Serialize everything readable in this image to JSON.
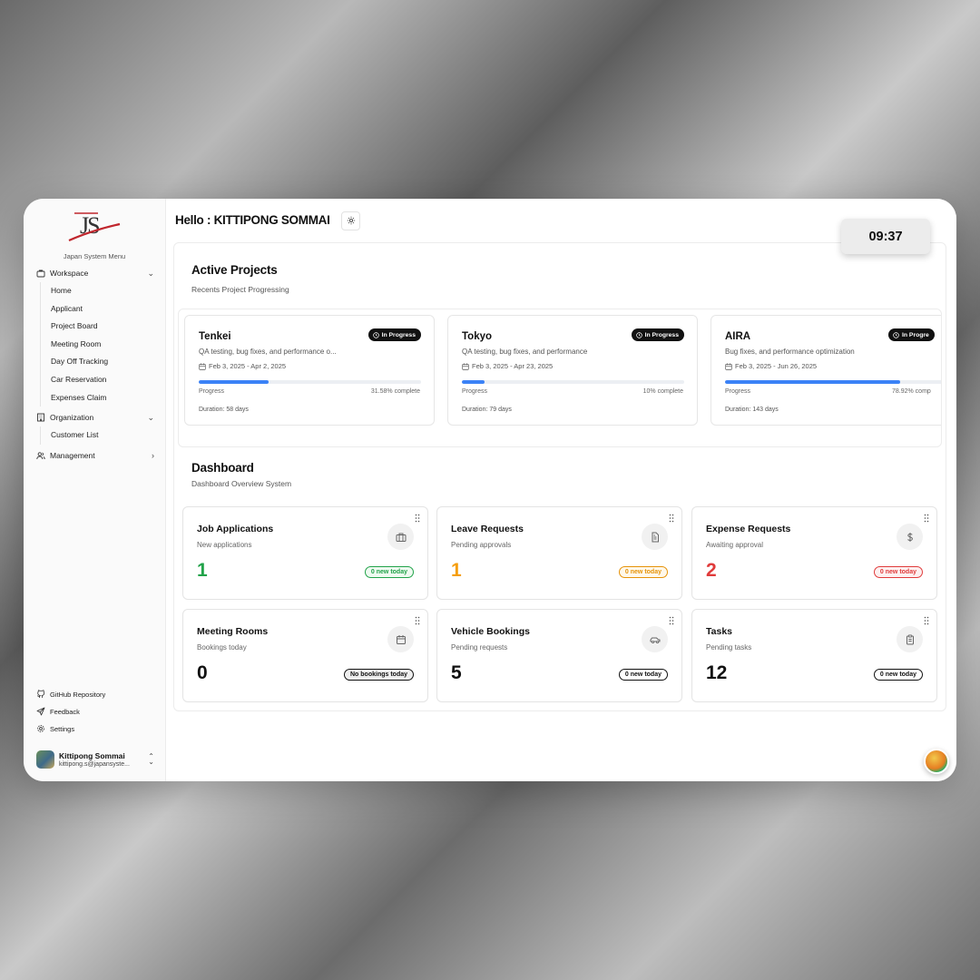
{
  "sidebar": {
    "menu_title": "Japan System Menu",
    "groups": {
      "workspace": {
        "label": "Workspace",
        "icon": "briefcase-icon",
        "items": [
          "Home",
          "Applicant",
          "Project Board",
          "Meeting Room",
          "Day Off Tracking",
          "Car Reservation",
          "Expenses Claim"
        ]
      },
      "organization": {
        "label": "Organization",
        "icon": "building-icon",
        "items": [
          "Customer List"
        ]
      },
      "management": {
        "label": "Management",
        "icon": "users-icon"
      }
    },
    "footer": {
      "github": "GitHub Repository",
      "feedback": "Feedback",
      "settings": "Settings"
    },
    "user": {
      "name": "Kittipong Sommai",
      "email": "kittipong.s@japansyste..."
    }
  },
  "header": {
    "greeting": "Hello : KITTIPONG SOMMAI",
    "clock": "09:37"
  },
  "projects_section": {
    "title": "Active Projects",
    "subtitle": "Recents Project Progressing",
    "projects": [
      {
        "name": "Tenkei",
        "status": "In Progress",
        "description": "QA testing, bug fixes, and performance o...",
        "dates": "Feb 3, 2025 - Apr 2, 2025",
        "progress_label": "Progress",
        "progress_text": "31.58% complete",
        "progress": 31.58,
        "duration": "Duration: 58 days"
      },
      {
        "name": "Tokyo",
        "status": "In Progress",
        "description": "QA testing, bug fixes, and performance",
        "dates": "Feb 3, 2025 - Apr 23, 2025",
        "progress_label": "Progress",
        "progress_text": "10% complete",
        "progress": 10,
        "duration": "Duration: 79 days"
      },
      {
        "name": "AIRA",
        "status": "In Progre",
        "description": "Bug fixes, and performance optimization",
        "dates": "Feb 3, 2025 - Jun 26, 2025",
        "progress_label": "Progress",
        "progress_text": "78.92% comp",
        "progress": 78.92,
        "duration": "Duration: 143 days"
      }
    ]
  },
  "dashboard": {
    "title": "Dashboard",
    "subtitle": "Dashboard Overview System",
    "cards": [
      {
        "title": "Job Applications",
        "subtitle": "New applications",
        "value": "1",
        "badge": "0 new today",
        "icon": "briefcase-icon",
        "value_color": "#22a34a",
        "badge_color": "#22a34a",
        "badge_bg": "#effaf1"
      },
      {
        "title": "Leave Requests",
        "subtitle": "Pending approvals",
        "value": "1",
        "badge": "0 new today",
        "icon": "file-icon",
        "value_color": "#f59e0b",
        "badge_color": "#e69309",
        "badge_bg": "#fff8ea"
      },
      {
        "title": "Expense Requests",
        "subtitle": "Awaiting approval",
        "value": "2",
        "badge": "0 new today",
        "icon": "dollar-icon",
        "value_color": "#e03b3b",
        "badge_color": "#e03b3b",
        "badge_bg": "#fdf0f0"
      },
      {
        "title": "Meeting Rooms",
        "subtitle": "Bookings today",
        "value": "0",
        "badge": "No bookings today",
        "icon": "calendar-icon",
        "value_color": "#111111",
        "badge_color": "#111111",
        "badge_bg": "#eeeeee"
      },
      {
        "title": "Vehicle Bookings",
        "subtitle": "Pending requests",
        "value": "5",
        "badge": "0 new today",
        "icon": "car-icon",
        "value_color": "#111111",
        "badge_color": "#111111",
        "badge_bg": "#ffffff"
      },
      {
        "title": "Tasks",
        "subtitle": "Pending tasks",
        "value": "12",
        "badge": "0 new today",
        "icon": "clipboard-icon",
        "value_color": "#111111",
        "badge_color": "#111111",
        "badge_bg": "#ffffff"
      }
    ]
  },
  "colors": {
    "progress_fill": "#3b82f6",
    "badge_dark": "#111111"
  }
}
